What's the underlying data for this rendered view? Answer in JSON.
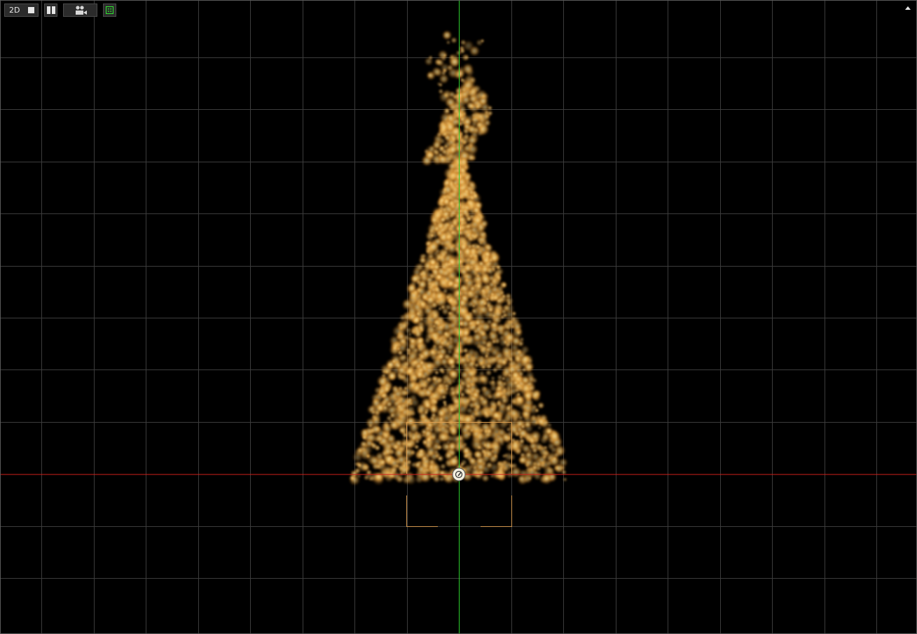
{
  "toolbar": {
    "mode_label": "2D",
    "mode_button_icon": "square-icon",
    "split_view_icon": "split-view-icon",
    "camera_icon": "movie-camera-icon",
    "frame_icon": "frame-selection-icon",
    "collapse_icon": "collapse-up-icon"
  },
  "viewport": {
    "background": "#000000",
    "grid_color": "#3c3c3c",
    "x_axis_color": "#d0201a",
    "y_axis_color": "#2ecf2e",
    "emitter_bounds_color": "#e0a050",
    "particle_core_color": "#ffd87a",
    "particle_edge_color": "#b05a10",
    "pivot_handle_icon": "pivot-handle-icon"
  }
}
